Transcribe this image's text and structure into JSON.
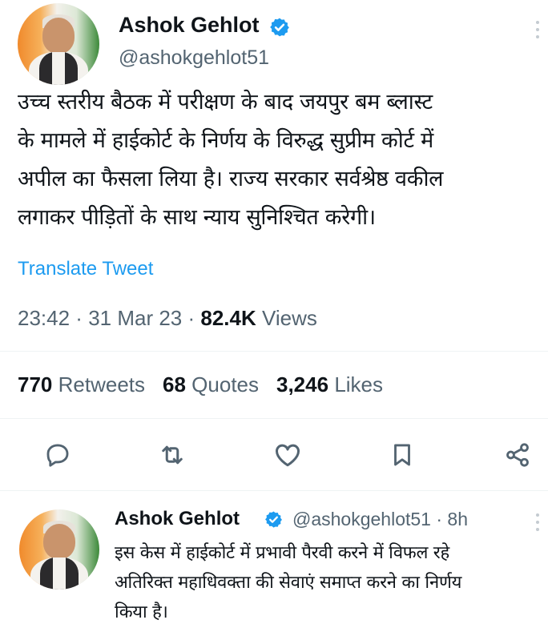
{
  "tweet": {
    "author_name": "Ashok Gehlot",
    "author_handle": "@ashokgehlot51",
    "text_lines": [
      "उच्च स्तरीय बैठक में परीक्षण के बाद जयपुर बम ब्लास्ट",
      "के मामले में हाईकोर्ट के निर्णय के विरुद्ध सुप्रीम कोर्ट में",
      "अपील का फैसला लिया है। राज्य सरकार सर्वश्रेष्ठ वकील",
      "लगाकर पीड़ितों के साथ न्याय सुनिश्चित करेगी।"
    ],
    "translate_label": "Translate Tweet",
    "time": "23:42",
    "date": "31 Mar 23",
    "separator": " · ",
    "views_count": "82.4K",
    "views_label": "Views",
    "retweets_count": "770",
    "retweets_label": "Retweets",
    "quotes_count": "68",
    "quotes_label": "Quotes",
    "likes_count": "3,246",
    "likes_label": "Likes"
  },
  "actions": {
    "reply_icon": "speech-bubble-icon",
    "retweet_icon": "retweet-arrows-icon",
    "like_icon": "heart-outline-icon",
    "bookmark_icon": "bookmark-icon",
    "share_icon": "share-nodes-icon"
  },
  "reply": {
    "author_name": "Ashok Gehlot",
    "author_handle": "@ashokgehlot51",
    "time_ago": "· 8h",
    "text_lines": [
      "इस केस में हाईकोर्ट में प्रभावी पैरवी करने में विफल रहे",
      "अतिरिक्त महाधिवक्ता की सेवाएं समाप्त करने का निर्णय",
      "किया है।"
    ]
  },
  "colors": {
    "text": "#0f1419",
    "secondary": "#536471",
    "link": "#1d9bf0",
    "verified": "#1d9bf0",
    "divider": "#eff3f4"
  }
}
